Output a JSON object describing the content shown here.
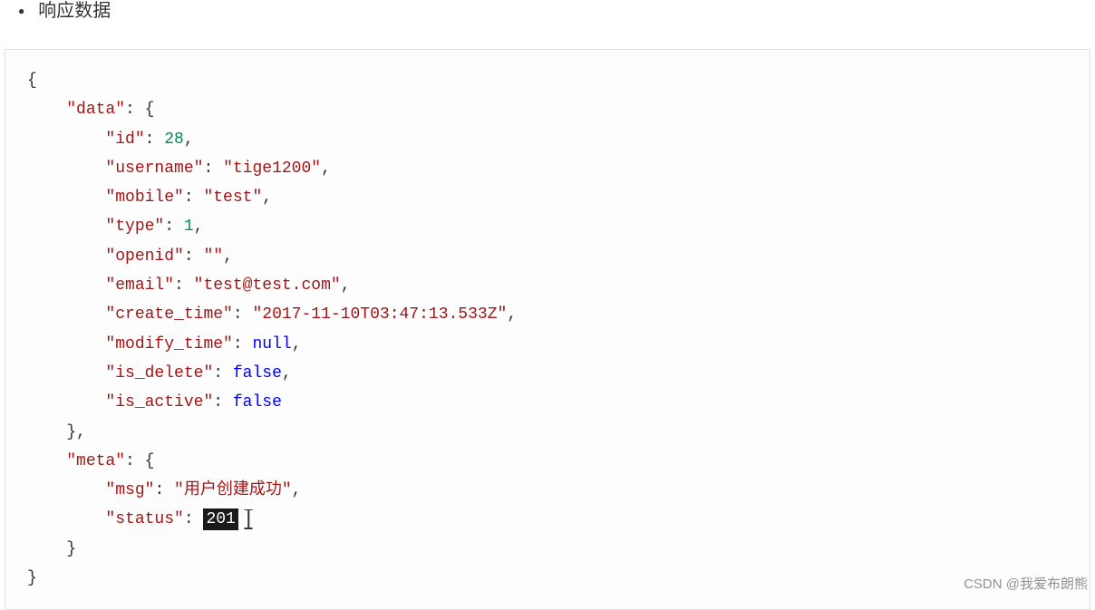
{
  "heading": "响应数据",
  "code": {
    "open_brace": "{",
    "data_key": "\"data\"",
    "data_open": ": {",
    "id_key": "\"id\"",
    "id_val": "28",
    "username_key": "\"username\"",
    "username_val": "\"tige1200\"",
    "mobile_key": "\"mobile\"",
    "mobile_val": "\"test\"",
    "type_key": "\"type\"",
    "type_val": "1",
    "openid_key": "\"openid\"",
    "openid_val": "\"\"",
    "email_key": "\"email\"",
    "email_val": "\"test@test.com\"",
    "create_time_key": "\"create_time\"",
    "create_time_val": "\"2017-11-10T03:47:13.533Z\"",
    "modify_time_key": "\"modify_time\"",
    "modify_time_val": "null",
    "is_delete_key": "\"is_delete\"",
    "is_delete_val": "false",
    "is_active_key": "\"is_active\"",
    "is_active_val": "false",
    "data_close": "},",
    "meta_key": "\"meta\"",
    "meta_open": ": {",
    "msg_key": "\"msg\"",
    "msg_val": "\"用户创建成功\"",
    "status_key": "\"status\"",
    "status_val": "201",
    "meta_close": "}",
    "close_brace": "}",
    "colon_space": ": ",
    "comma": ","
  },
  "watermark": "CSDN @我爱布朗熊"
}
